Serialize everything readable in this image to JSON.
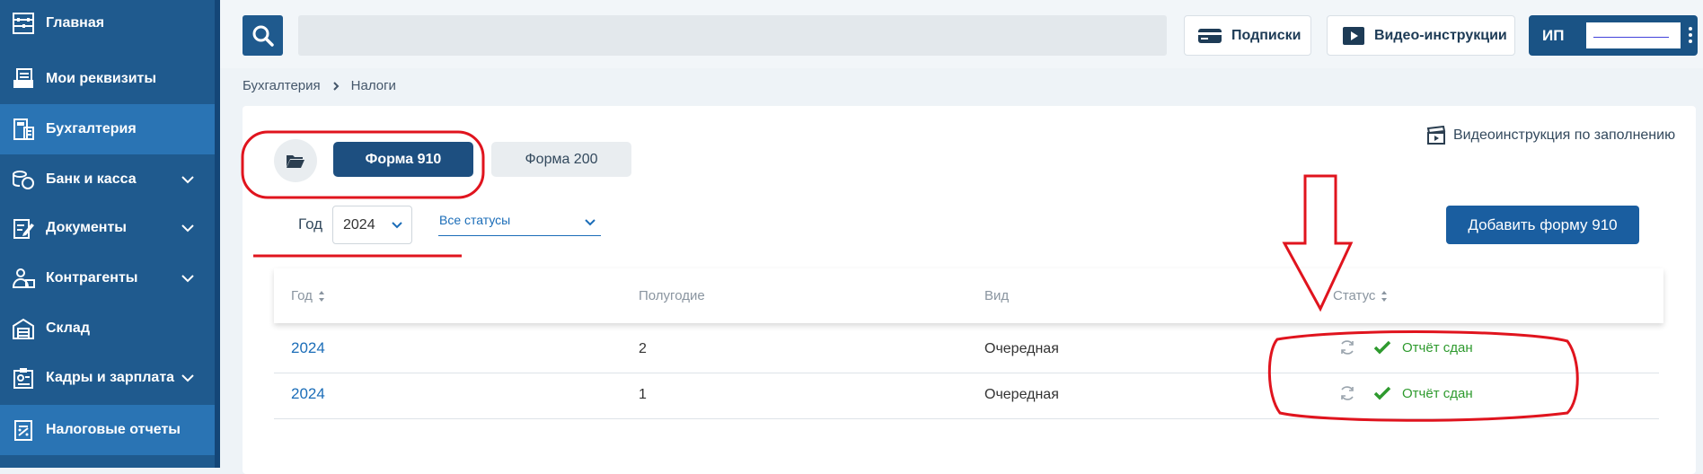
{
  "sidebar": {
    "items": [
      {
        "label": "Главная",
        "icon": "abacus-icon"
      },
      {
        "label": "Мои реквизиты",
        "icon": "requisites-icon"
      },
      {
        "label": "Бухгалтерия",
        "icon": "calculator-icon"
      },
      {
        "label": "Банк и касса",
        "icon": "coins-icon"
      },
      {
        "label": "Документы",
        "icon": "document-edit-icon"
      },
      {
        "label": "Контрагенты",
        "icon": "contacts-icon"
      },
      {
        "label": "Склад",
        "icon": "warehouse-icon"
      },
      {
        "label": "Кадры и зарплата",
        "icon": "staff-icon"
      },
      {
        "label": "Налоговые отчеты",
        "icon": "tax-report-icon"
      }
    ]
  },
  "header": {
    "search_placeholder": "",
    "subscriptions_label": "Подписки",
    "video_instructions_label": "Видео-инструкции",
    "account_type": "ИП",
    "account_name": "——————"
  },
  "breadcrumb": {
    "items": [
      "Бухгалтерия",
      "Налоги"
    ]
  },
  "main": {
    "tabs": [
      {
        "label": "Форма 910",
        "active": true
      },
      {
        "label": "Форма 200",
        "active": false
      }
    ],
    "video_fill_label": "Видеоинструкция по заполнению",
    "filters": {
      "year_label": "Год",
      "year_value": "2024",
      "status_value": "Все статусы"
    },
    "add_button_label": "Добавить форму 910",
    "table": {
      "columns": [
        "Год",
        "Полугодие",
        "Вид",
        "Статус"
      ],
      "rows": [
        {
          "year": "2024",
          "half": "2",
          "kind": "Очередная",
          "status": "Отчёт сдан"
        },
        {
          "year": "2024",
          "half": "1",
          "kind": "Очередная",
          "status": "Отчёт сдан"
        }
      ]
    }
  },
  "colors": {
    "sidebar_bg": "#1f5a8e",
    "sidebar_active": "#2a74b4",
    "primary_button": "#1a5ea0",
    "status_ok": "#2e9a2e",
    "annotation_red": "#e0141e"
  }
}
